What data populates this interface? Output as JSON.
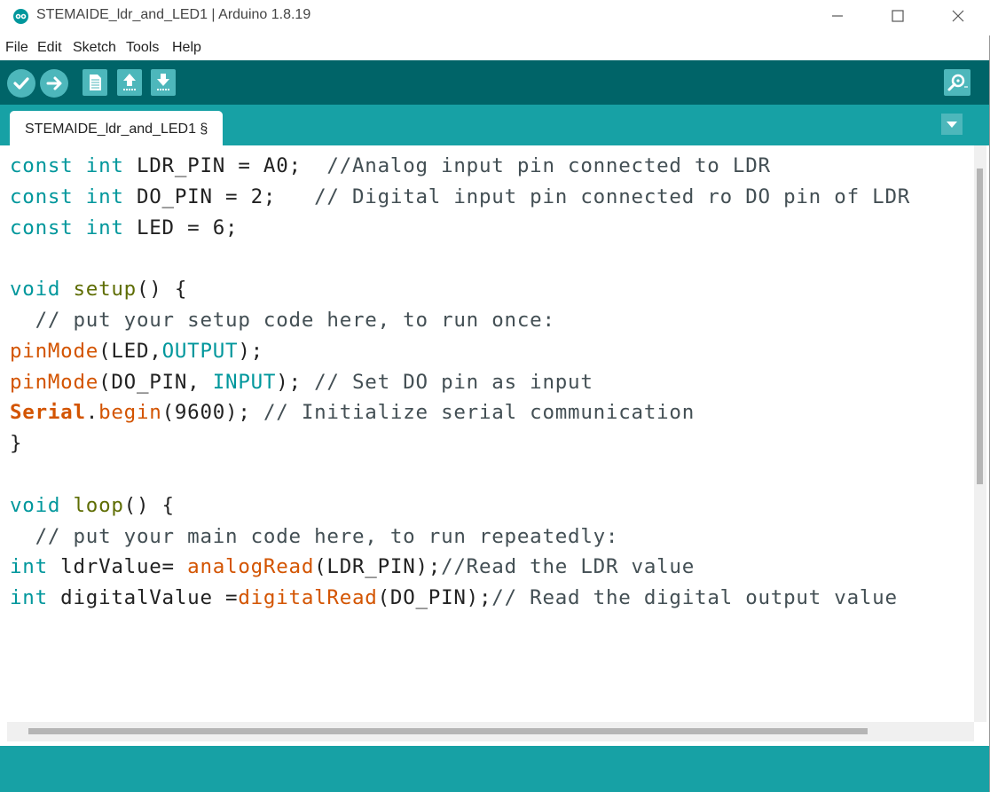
{
  "window": {
    "title": "STEMAIDE_ldr_and_LED1 | Arduino 1.8.19",
    "minimize_glyph": "—",
    "maximize_glyph": "☐",
    "close_glyph": "✕"
  },
  "menu": [
    "File",
    "Edit",
    "Sketch",
    "Tools",
    "Help"
  ],
  "toolbar": {
    "verify_icon": "checkmark-icon",
    "upload_icon": "arrow-right-icon",
    "new_icon": "document-icon",
    "open_icon": "arrow-up-icon",
    "save_icon": "arrow-down-icon",
    "serial_monitor_icon": "magnifier-icon"
  },
  "tab": {
    "label": "STEMAIDE_ldr_and_LED1 §"
  },
  "code_lines": [
    [
      {
        "t": "const",
        "c": "kw"
      },
      {
        "t": " "
      },
      {
        "t": "int",
        "c": "kw"
      },
      {
        "t": " LDR_PIN = A0;  "
      },
      {
        "t": "//Analog input pin connected to LDR",
        "c": "cm"
      }
    ],
    [
      {
        "t": "const",
        "c": "kw"
      },
      {
        "t": " "
      },
      {
        "t": "int",
        "c": "kw"
      },
      {
        "t": " DO_PIN = 2;   "
      },
      {
        "t": "// Digital input pin connected ro DO pin of LDR",
        "c": "cm"
      }
    ],
    [
      {
        "t": "const",
        "c": "kw"
      },
      {
        "t": " "
      },
      {
        "t": "int",
        "c": "kw"
      },
      {
        "t": " LED = 6;"
      }
    ],
    [],
    [
      {
        "t": "void",
        "c": "kw"
      },
      {
        "t": " "
      },
      {
        "t": "setup",
        "c": "fn"
      },
      {
        "t": "() {"
      }
    ],
    [
      {
        "t": "  "
      },
      {
        "t": "// put your setup code here, to run once:",
        "c": "cm"
      }
    ],
    [
      {
        "t": "pinMode",
        "c": "rw"
      },
      {
        "t": "(LED,"
      },
      {
        "t": "OUTPUT",
        "c": "kw"
      },
      {
        "t": ");"
      }
    ],
    [
      {
        "t": "pinMode",
        "c": "rw"
      },
      {
        "t": "(DO_PIN, "
      },
      {
        "t": "INPUT",
        "c": "kw"
      },
      {
        "t": "); "
      },
      {
        "t": "// Set DO pin as input",
        "c": "cm"
      }
    ],
    [
      {
        "t": "Serial",
        "c": "sr"
      },
      {
        "t": "."
      },
      {
        "t": "begin",
        "c": "rw"
      },
      {
        "t": "(9600); "
      },
      {
        "t": "// Initialize serial communication",
        "c": "cm"
      }
    ],
    [
      {
        "t": "}"
      }
    ],
    [],
    [
      {
        "t": "void",
        "c": "kw"
      },
      {
        "t": " "
      },
      {
        "t": "loop",
        "c": "fn"
      },
      {
        "t": "() {"
      }
    ],
    [
      {
        "t": "  "
      },
      {
        "t": "// put your main code here, to run repeatedly:",
        "c": "cm"
      }
    ],
    [
      {
        "t": "int",
        "c": "kw"
      },
      {
        "t": " ldrValue= "
      },
      {
        "t": "analogRead",
        "c": "rw"
      },
      {
        "t": "(LDR_PIN);"
      },
      {
        "t": "//Read the LDR value",
        "c": "cm"
      }
    ],
    [
      {
        "t": "int",
        "c": "kw"
      },
      {
        "t": " digitalValue ="
      },
      {
        "t": "digitalRead",
        "c": "rw"
      },
      {
        "t": "(DO_PIN);"
      },
      {
        "t": "// Read the digital output value",
        "c": "cm"
      }
    ]
  ],
  "colors": {
    "toolbar_bg": "#006468",
    "tabstrip_bg": "#17a1a5",
    "button_bg": "#4db7bb",
    "keyword": "#00979c",
    "function": "#5e6d03",
    "builtin": "#d35400",
    "comment": "#434f54"
  }
}
